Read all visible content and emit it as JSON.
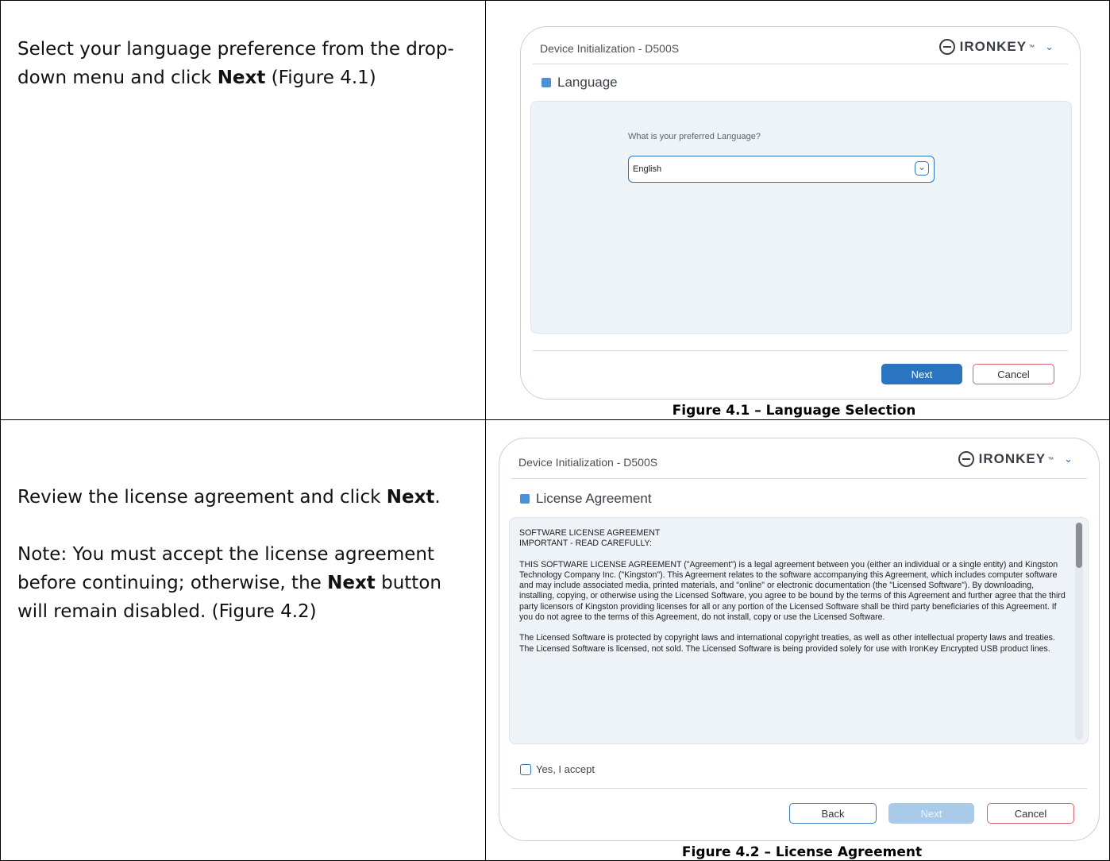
{
  "row1": {
    "instruction_pre": "Select your language preference from the drop-down menu and click ",
    "instruction_bold": "Next",
    "instruction_post": " (Figure 4.1)",
    "caption": "Figure 4.1 – Language Selection"
  },
  "row2": {
    "instruction_pre": "Review the license agreement and click ",
    "instruction_bold": "Next",
    "instruction_post": ".",
    "note_pre": "Note: You must accept the license agreement before continuing; otherwise, the ",
    "note_bold": "Next",
    "note_post": " button will remain disabled. (Figure 4.2)",
    "caption": "Figure 4.2 – License Agreement"
  },
  "window1": {
    "title": "Device Initialization - D500S",
    "brand": "IRONKEY",
    "section": "Language",
    "question": "What is your preferred Language?",
    "select_value": "English",
    "next": "Next",
    "cancel": "Cancel"
  },
  "window2": {
    "title": "Device Initialization - D500S",
    "brand": "IRONKEY",
    "section": "License Agreement",
    "heading1": "SOFTWARE LICENSE AGREEMENT",
    "heading2": "IMPORTANT - READ CAREFULLY:",
    "para1": "THIS SOFTWARE LICENSE AGREEMENT (\"Agreement\") is a legal agreement between you (either an individual or a single entity) and Kingston Technology Company Inc. (\"Kingston\"). This Agreement relates to the software accompanying this Agreement, which includes computer software and may include associated media, printed materials, and \"online\" or electronic documentation (the \"Licensed Software\"). By downloading, installing, copying, or otherwise using the Licensed Software, you agree to be bound by the terms of this Agreement and further agree that the third party licensors of Kingston providing licenses for all or any portion of the Licensed Software shall be third party beneficiaries of this Agreement. If you do not agree to the terms of this Agreement, do not install, copy or use the Licensed Software.",
    "para2": "The Licensed Software is protected by copyright laws and international copyright treaties, as well as other intellectual property laws and treaties. The Licensed Software is licensed, not sold. The Licensed Software is being provided solely for use with IronKey Encrypted USB product lines.",
    "accept_label": "Yes, I accept",
    "back": "Back",
    "next": "Next",
    "cancel": "Cancel"
  },
  "colors": {
    "accent": "#2b74c2",
    "cancel_border": "#d9606e",
    "panel_bg": "#eef3f8"
  },
  "icons": {
    "brand_logo": "key-ring-icon",
    "dropdown": "chevron-down-icon",
    "section": "document-icon"
  }
}
